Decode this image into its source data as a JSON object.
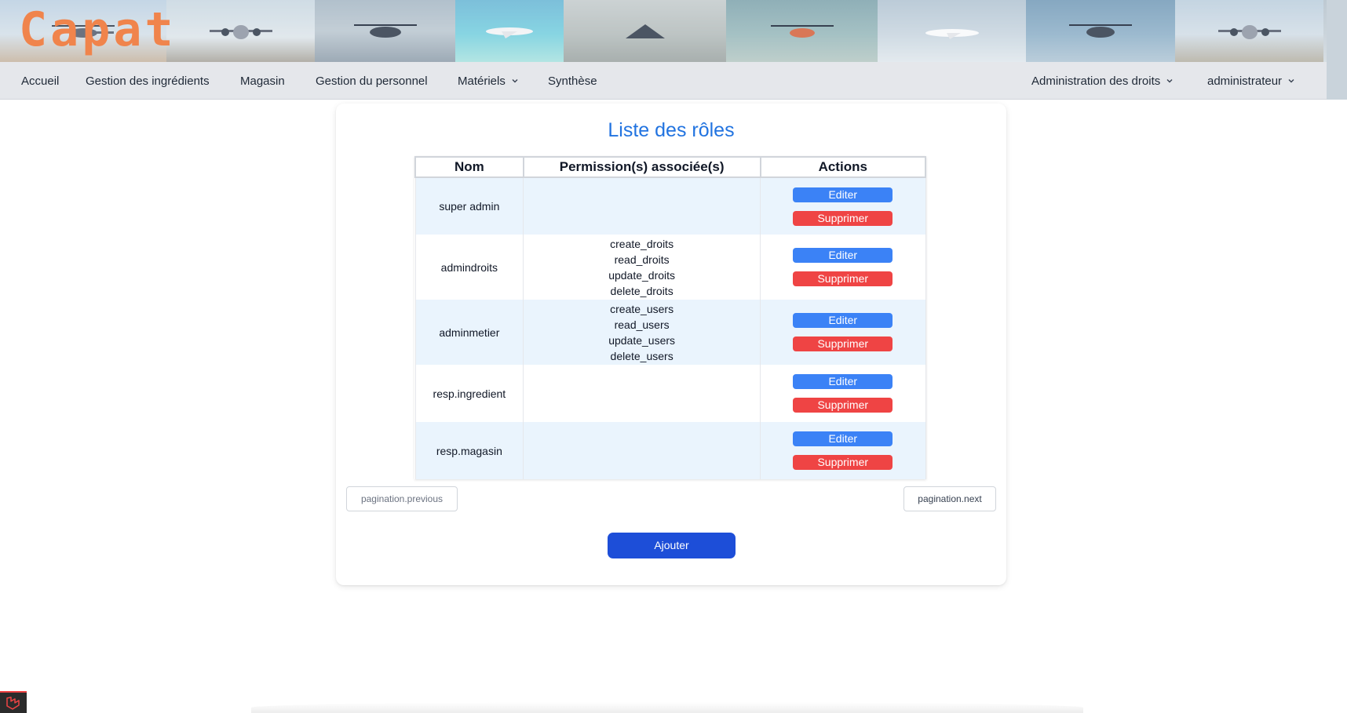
{
  "app": {
    "logo_text": "Capat",
    "brand_color": "#f0844c"
  },
  "banner": {
    "photos": [
      "helicopter",
      "patrol-plane",
      "helicopter",
      "business-jet",
      "fighter-jet",
      "helicopter",
      "business-jet",
      "helicopter",
      "patrol-plane"
    ]
  },
  "nav": {
    "left": [
      {
        "label": "Accueil"
      },
      {
        "label": "Gestion des ingrédients"
      },
      {
        "label": "Magasin"
      },
      {
        "label": "Gestion du personnel"
      },
      {
        "label": "Matériels",
        "dropdown": true
      },
      {
        "label": "Synthèse"
      }
    ],
    "right": [
      {
        "label": "Administration des droits",
        "dropdown": true
      },
      {
        "label": "administrateur",
        "dropdown": true
      }
    ]
  },
  "page": {
    "title": "Liste des rôles",
    "title_color": "#2173e0"
  },
  "table": {
    "headers": {
      "name": "Nom",
      "permissions": "Permission(s) associée(s)",
      "actions": "Actions"
    },
    "rows": [
      {
        "name": "super admin",
        "permissions": []
      },
      {
        "name": "admindroits",
        "permissions": [
          "create_droits",
          "read_droits",
          "update_droits",
          "delete_droits"
        ]
      },
      {
        "name": "adminmetier",
        "permissions": [
          "create_users",
          "read_users",
          "update_users",
          "delete_users"
        ]
      },
      {
        "name": "resp.ingredient",
        "permissions": []
      },
      {
        "name": "resp.magasin",
        "permissions": []
      }
    ],
    "edit_label": "Editer",
    "delete_label": "Supprimer",
    "edit_color": "#3b82f6",
    "delete_color": "#ef4444"
  },
  "pagination": {
    "previous": "pagination.previous",
    "next": "pagination.next"
  },
  "add_button": {
    "label": "Ajouter",
    "color": "#1d4ed8"
  }
}
